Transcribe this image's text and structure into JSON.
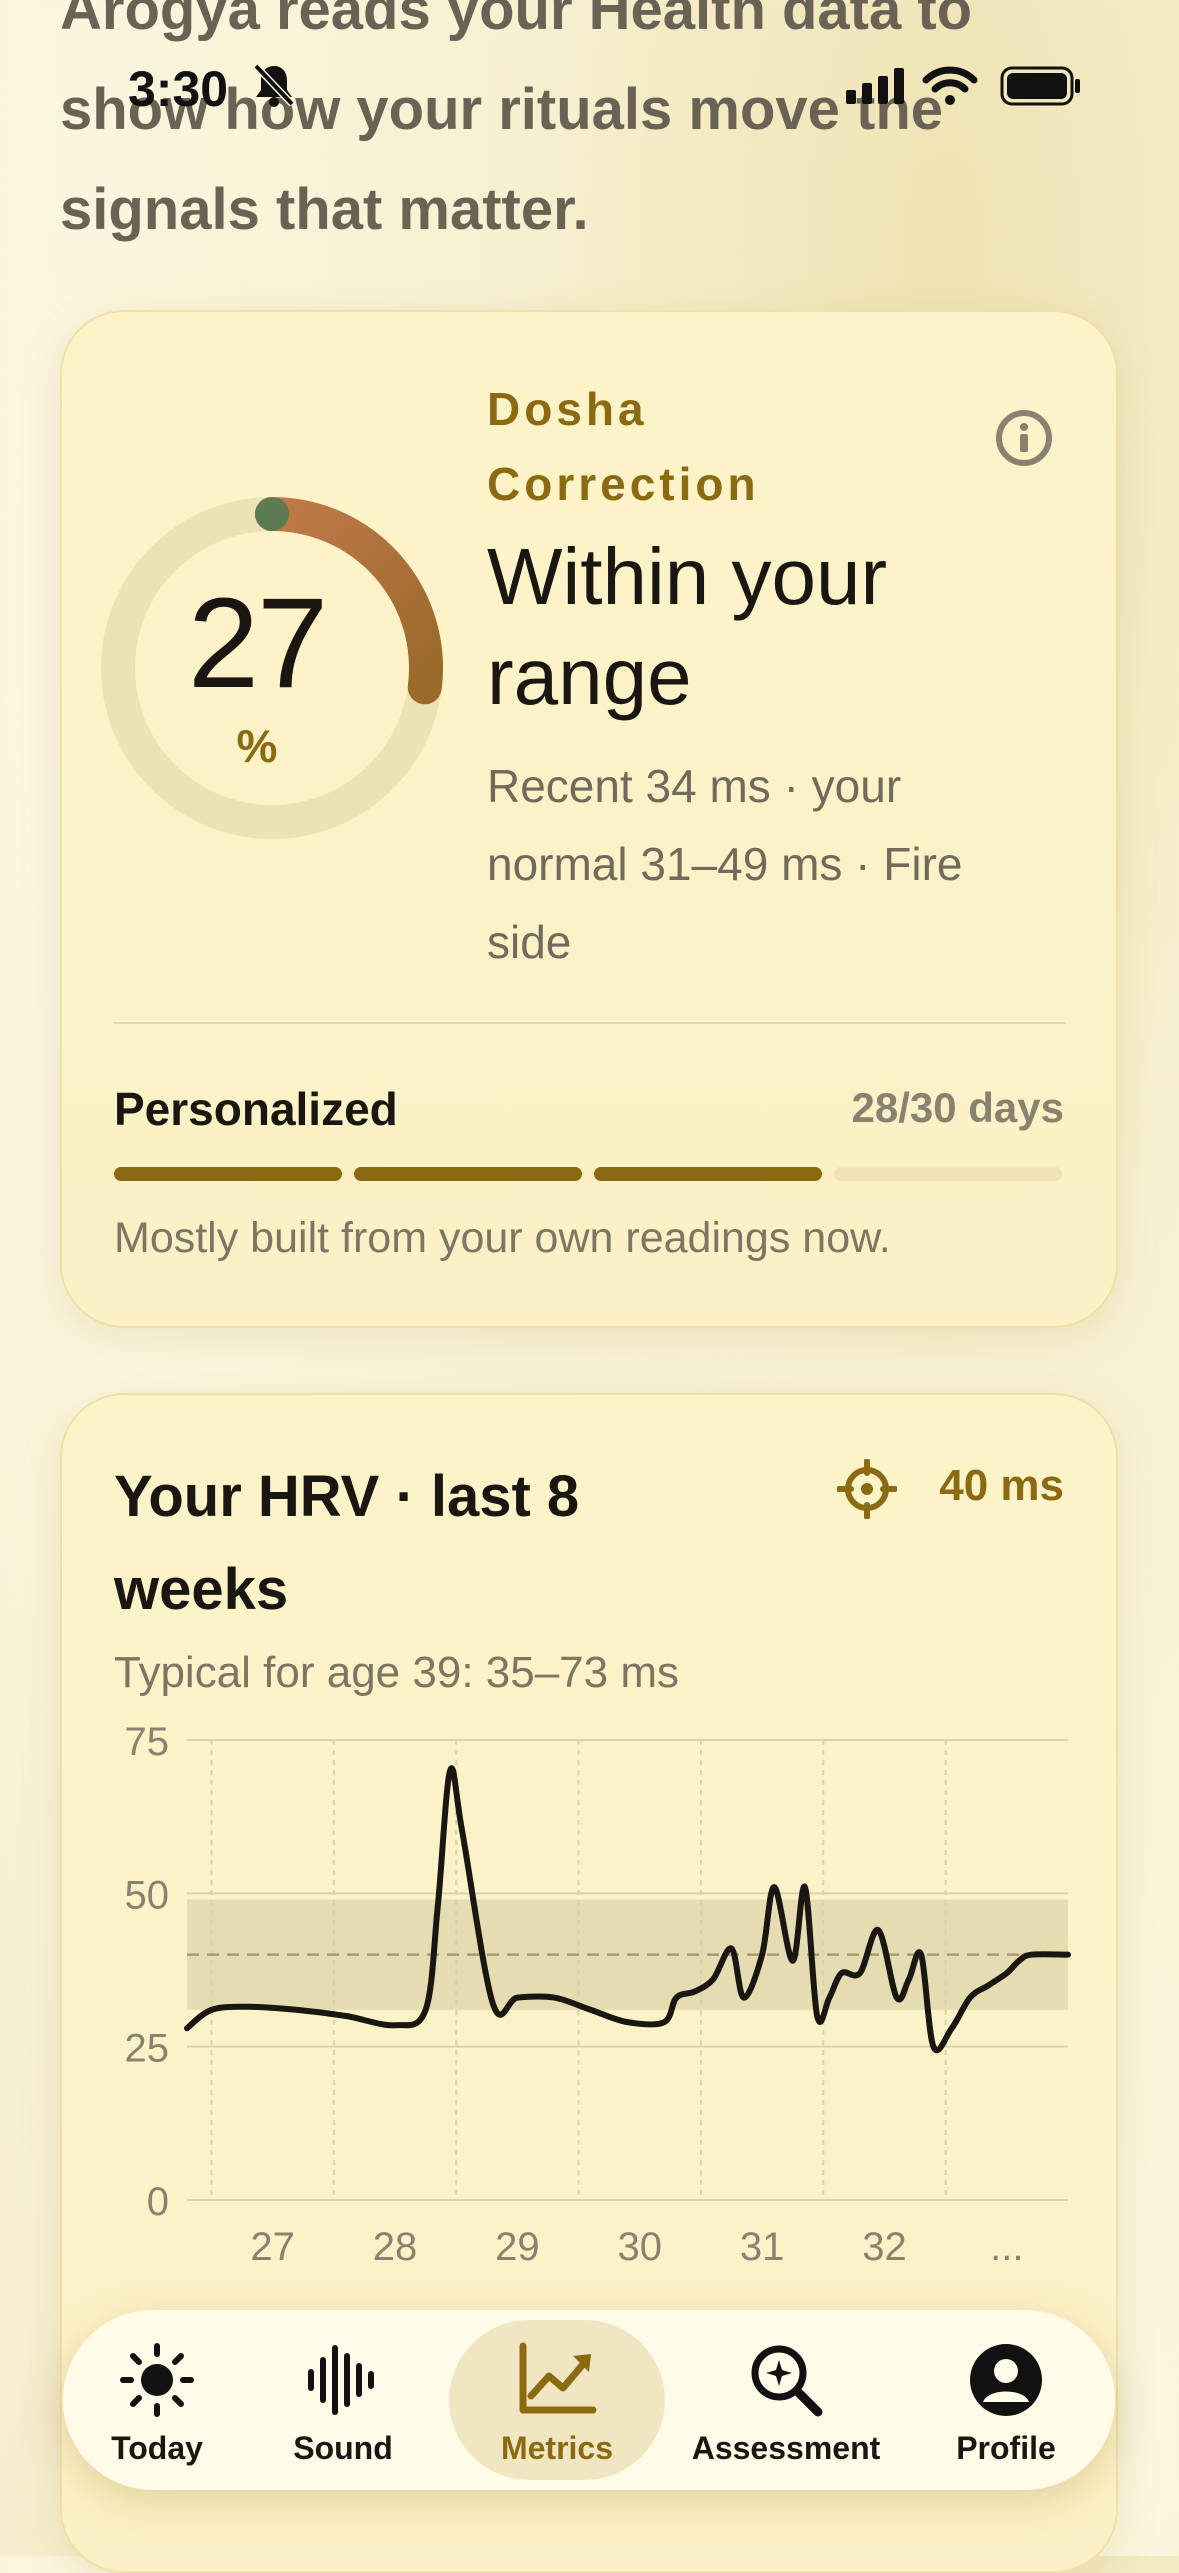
{
  "intro_text": "Arogya reads your Health data to show how your rituals move the signals that matter.",
  "status_bar": {
    "time": "3:30"
  },
  "dosha_card": {
    "percent": 27,
    "percent_unit": "%",
    "eyebrow": "Dosha Correction",
    "status_title": "Within your range",
    "status_description": "Recent 34 ms · your normal 31–49 ms · Fire side",
    "personalized_label": "Personalized",
    "personalized_days": "28/30 days",
    "progress_segments_filled": 3,
    "progress_segments_total": 4,
    "personalized_note": "Mostly built from your own readings now.",
    "colors": {
      "accent": "#8b6a12",
      "ring_start": "#5e7a52",
      "ring_mid": "#c0794a",
      "ring_end": "#9a6a2a"
    }
  },
  "hrv_card": {
    "title": "Your HRV · last 8 weeks",
    "target_value": "40 ms",
    "typical_text": "Typical for age 39: 35–73 ms"
  },
  "chart_data": {
    "type": "line",
    "ylim": [
      0,
      75
    ],
    "y_ticks": [
      "0",
      "25",
      "50",
      "75"
    ],
    "x_tick_labels": [
      "27",
      "28",
      "29",
      "30",
      "31",
      "32",
      "..."
    ],
    "normal_band": [
      31,
      49
    ],
    "reference_line": 40,
    "series": [
      {
        "x": [
          26.3,
          26.5,
          26.8,
          27.2,
          27.6,
          28.0,
          28.25,
          28.35,
          28.45,
          28.55,
          28.8,
          29.0,
          29.3,
          29.6,
          29.9,
          30.2,
          30.3,
          30.45,
          30.6,
          30.75,
          30.85,
          31.0,
          31.1,
          31.25,
          31.35,
          31.45,
          31.55,
          31.65,
          31.8,
          31.95,
          32.1,
          32.2,
          32.3,
          32.4,
          32.55,
          32.7,
          32.85,
          33.0,
          33.1,
          33.2,
          33.5
        ],
        "y": [
          28,
          31,
          31.5,
          31,
          30,
          28.5,
          31,
          48,
          70,
          60,
          32,
          33,
          33,
          31,
          29,
          29,
          33,
          34,
          36,
          41,
          33,
          40,
          51,
          39,
          51,
          30,
          33,
          37,
          37,
          44,
          33,
          36,
          40,
          25,
          28,
          33,
          35,
          37,
          39,
          40,
          40
        ]
      }
    ]
  },
  "tab_bar": {
    "tabs": [
      {
        "label": "Today",
        "icon": "sun-icon"
      },
      {
        "label": "Sound",
        "icon": "waveform-icon"
      },
      {
        "label": "Metrics",
        "icon": "chart-line-icon",
        "active": true
      },
      {
        "label": "Assessment",
        "icon": "magnify-sparkle-icon"
      },
      {
        "label": "Profile",
        "icon": "person-circle-icon"
      }
    ]
  }
}
